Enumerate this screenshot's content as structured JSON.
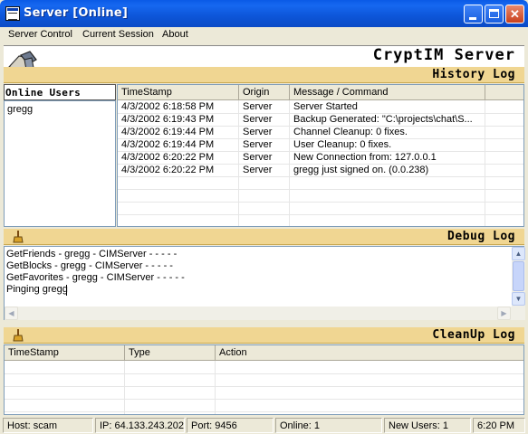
{
  "window": {
    "title": "Server [Online]"
  },
  "menu": [
    "Server Control",
    "Current Session",
    "About"
  ],
  "app": {
    "title": "CryptIM Server"
  },
  "history": {
    "label": "History Log",
    "columns": [
      "TimeStamp",
      "Origin",
      "Message / Command"
    ],
    "rows": [
      [
        "4/3/2002 6:18:58 PM",
        "Server",
        "Server Started"
      ],
      [
        "4/3/2002 6:19:43 PM",
        "Server",
        "Backup Generated: \"C:\\projects\\chat\\S..."
      ],
      [
        "4/3/2002 6:19:44 PM",
        "Server",
        "Channel Cleanup: 0 fixes."
      ],
      [
        "4/3/2002 6:19:44 PM",
        "Server",
        "User Cleanup: 0 fixes."
      ],
      [
        "4/3/2002 6:20:22 PM",
        "Server",
        "New Connection from: 127.0.0.1"
      ],
      [
        "4/3/2002 6:20:22 PM",
        "Server",
        "gregg just signed on. (0.0.238)"
      ]
    ]
  },
  "online": {
    "header": "Online Users",
    "users": [
      "gregg"
    ]
  },
  "debug": {
    "label": "Debug Log",
    "lines": [
      "GetFriends - gregg - CIMServer - - - - -",
      "GetBlocks - gregg - CIMServer - - - - -",
      "GetFavorites - gregg - CIMServer - - - - -",
      "Pinging gregg"
    ]
  },
  "cleanup": {
    "label": "CleanUp Log",
    "columns": [
      "TimeStamp",
      "Type",
      "Action"
    ]
  },
  "status": {
    "host": "Host: scam",
    "ip": "IP: 64.133.243.202",
    "port": "Port: 9456",
    "online": "Online: 1",
    "new_users": "New Users: 1",
    "time": "6:20 PM"
  },
  "colors": {
    "title_blue": "#0a5ae6",
    "band_gold": "#f0d692",
    "chrome": "#ece9d8"
  }
}
